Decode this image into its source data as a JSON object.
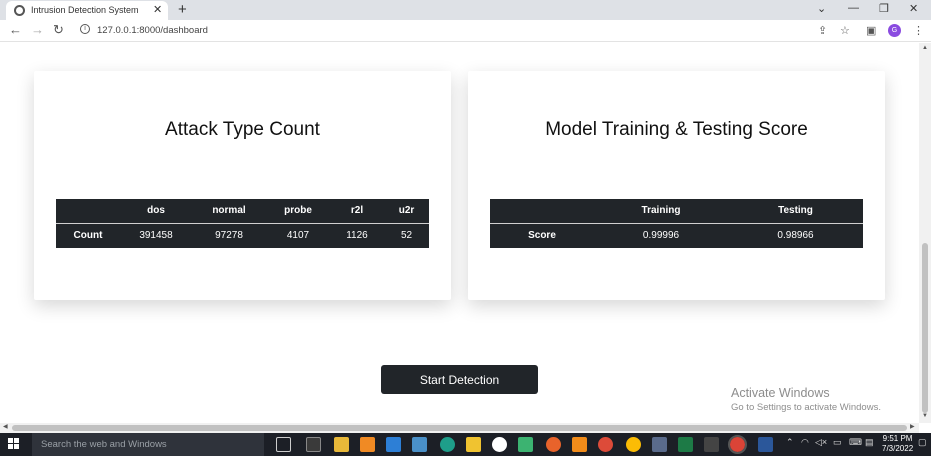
{
  "browser": {
    "tab_title": "Intrusion Detection System",
    "url": "127.0.0.1:8000/dashboard",
    "profile_initial": "G"
  },
  "attack_card": {
    "title": "Attack Type Count",
    "columns": [
      "",
      "dos",
      "normal",
      "probe",
      "r2l",
      "u2r"
    ],
    "rows": [
      {
        "label": "Count",
        "values": [
          "391458",
          "97278",
          "4107",
          "1126",
          "52"
        ]
      }
    ]
  },
  "score_card": {
    "title": "Model Training & Testing Score",
    "columns": [
      "",
      "Training",
      "Testing"
    ],
    "rows": [
      {
        "label": "Score",
        "values": [
          "0.99996",
          "0.98966"
        ]
      }
    ]
  },
  "actions": {
    "start_detection_label": "Start Detection"
  },
  "watermark": {
    "line1": "Activate Windows",
    "line2": "Go to Settings to activate Windows."
  },
  "taskbar": {
    "search_placeholder": "Search the web and Windows",
    "time": "9:51 PM",
    "date": "7/3/2022"
  },
  "colors": {
    "table_bg": "#212529",
    "button_bg": "#212529",
    "profile": "#8a4be0"
  }
}
